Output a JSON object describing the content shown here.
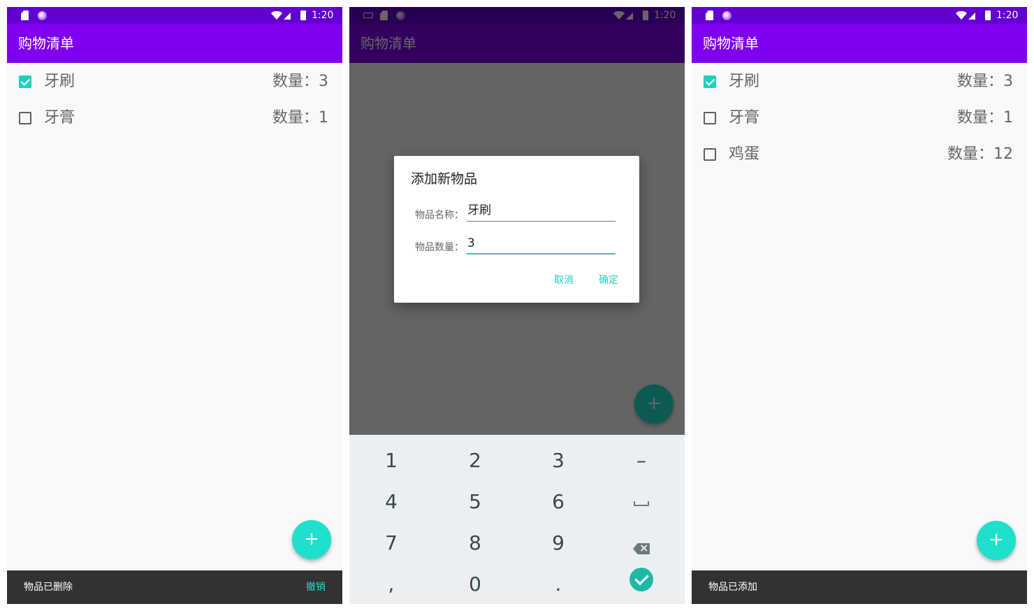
{
  "status": {
    "time": "1:20"
  },
  "app": {
    "title": "购物清单"
  },
  "screens": {
    "left": {
      "items": [
        {
          "name": "牙刷",
          "qty": "数量：3",
          "checked": true
        },
        {
          "name": "牙膏",
          "qty": "数量：1",
          "checked": false
        }
      ],
      "snackbar": {
        "text": "物品已删除",
        "action": "撤销"
      }
    },
    "middle": {
      "dialog": {
        "title": "添加新物品",
        "name_label": "物品名称：",
        "name_value": "牙刷",
        "qty_label": "物品数量：",
        "qty_value": "3",
        "cancel": "取消",
        "ok": "确定"
      },
      "keypad": {
        "keys": [
          "1",
          "2",
          "3",
          "–",
          "4",
          "5",
          "6",
          "",
          "7",
          "8",
          "9",
          "",
          ",",
          "0",
          ".",
          ""
        ],
        "special": [
          "space-key",
          "backspace-key",
          "done-key"
        ]
      }
    },
    "right": {
      "items": [
        {
          "name": "牙刷",
          "qty": "数量：3",
          "checked": true
        },
        {
          "name": "牙膏",
          "qty": "数量：1",
          "checked": false
        },
        {
          "name": "鸡蛋",
          "qty": "数量：12",
          "checked": false
        }
      ],
      "snackbar": {
        "text": "物品已添加"
      }
    }
  },
  "colors": {
    "statusbar": "#6200d0",
    "appbar": "#7f00ee",
    "accent": "#1fe0cc",
    "snackbar": "#323232",
    "keypad_bg": "#eceff1"
  },
  "icons": [
    "sd-card-icon",
    "notification-circle-icon",
    "keyboard-icon",
    "wifi-icon",
    "signal-icon",
    "battery-icon",
    "checkbox-icon",
    "add-icon",
    "backspace-icon",
    "space-icon",
    "check-icon"
  ]
}
